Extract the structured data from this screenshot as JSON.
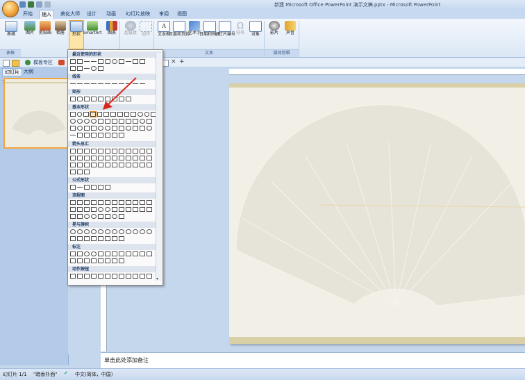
{
  "window": {
    "title": "新建 Microsoft Office PowerPoint 演示文稿.pptx - Microsoft PowerPoint"
  },
  "tabs": [
    "开始",
    "插入",
    "美化大师",
    "设计",
    "动画",
    "幻灯片放映",
    "审阅",
    "视图"
  ],
  "active_tab": "插入",
  "ribbon": {
    "buttons": {
      "table": "表格",
      "picture": "图片",
      "clipart": "剪贴画",
      "album": "相册",
      "shapes": "形状",
      "smartart": "SmartArt",
      "chart": "图表",
      "hyperlink": "超链接",
      "action": "动作",
      "textbox": "文本框",
      "header_footer": "页眉和页脚",
      "wordart": "艺术字",
      "datetime": "日期和时间",
      "slide_number": "幻灯片编号",
      "symbol": "符号",
      "object": "对象",
      "movie": "影片",
      "sound": "声音"
    },
    "groups": {
      "tables": "表格",
      "text": "文本",
      "media": "媒体剪辑"
    }
  },
  "toolbar2": {
    "template_label": "模板专区"
  },
  "left_panel": {
    "tab_slides": "幻灯片",
    "tab_outline": "大纲",
    "slide_number": "1"
  },
  "shapes_dropdown": {
    "sections": [
      "最近使用的形状",
      "线条",
      "矩形",
      "基本形状",
      "箭头总汇",
      "公式形状",
      "流程图",
      "星与旗帜",
      "标注",
      "动作按钮"
    ]
  },
  "notes": {
    "placeholder": "单击此处添加备注"
  },
  "status": {
    "slide_info": "幻灯片 1/1",
    "theme": "\"暗香扑面\"",
    "language": "中文(简体，中国)"
  },
  "colors": {
    "accent_orange": "#f4a63c",
    "ribbon_blue": "#dbe7f5",
    "arrow_red": "#d9261c"
  }
}
